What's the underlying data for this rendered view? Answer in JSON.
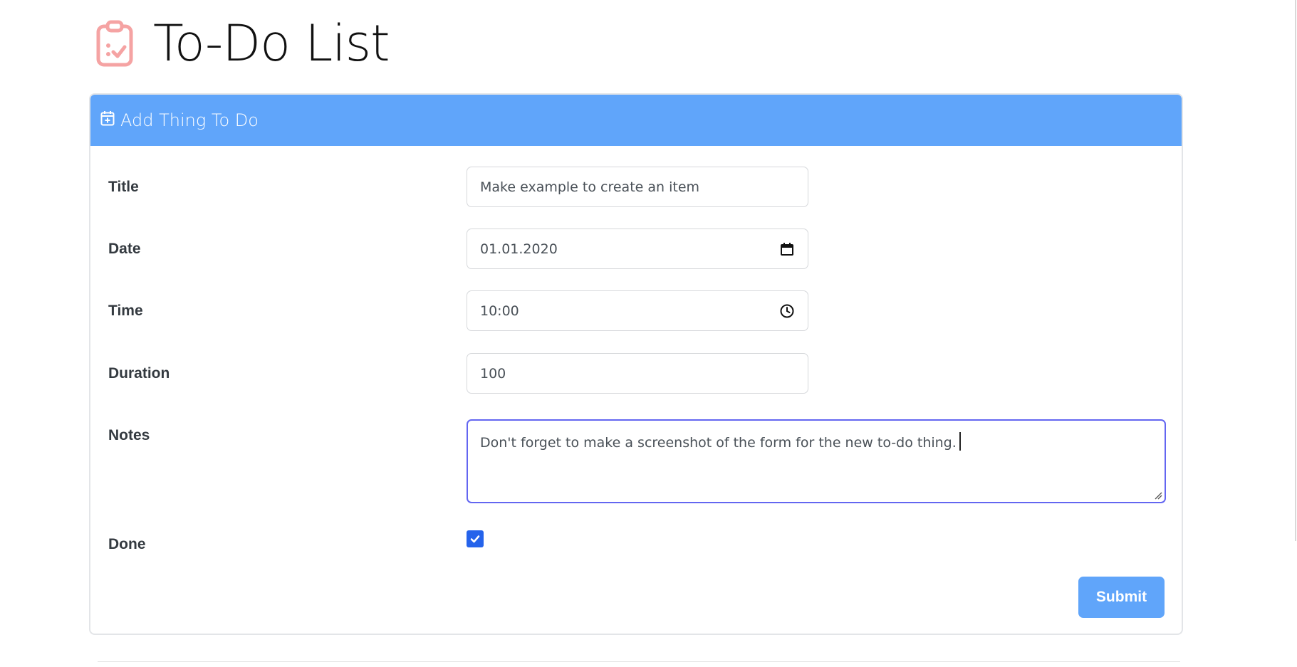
{
  "app": {
    "title": "To-Do List",
    "icon": "clipboard-check-icon",
    "icon_color": "#f5a3a3"
  },
  "form": {
    "header_title": "Add Thing To Do",
    "header_icon": "calendar-plus-icon",
    "header_color": "#60a5fa",
    "fields": {
      "title": {
        "label": "Title",
        "value": "Make example to create an item"
      },
      "date": {
        "label": "Date",
        "value": "01.01.2020",
        "icon": "calendar-icon"
      },
      "time": {
        "label": "Time",
        "value": "10:00",
        "icon": "clock-icon"
      },
      "duration": {
        "label": "Duration",
        "value": "100"
      },
      "notes": {
        "label": "Notes",
        "value": "Don't forget to make a screenshot of the form for the new to-do thing."
      },
      "done": {
        "label": "Done",
        "checked": true
      }
    },
    "submit_label": "Submit",
    "focus_color": "#6366f1",
    "checkbox_color": "#2563eb"
  }
}
